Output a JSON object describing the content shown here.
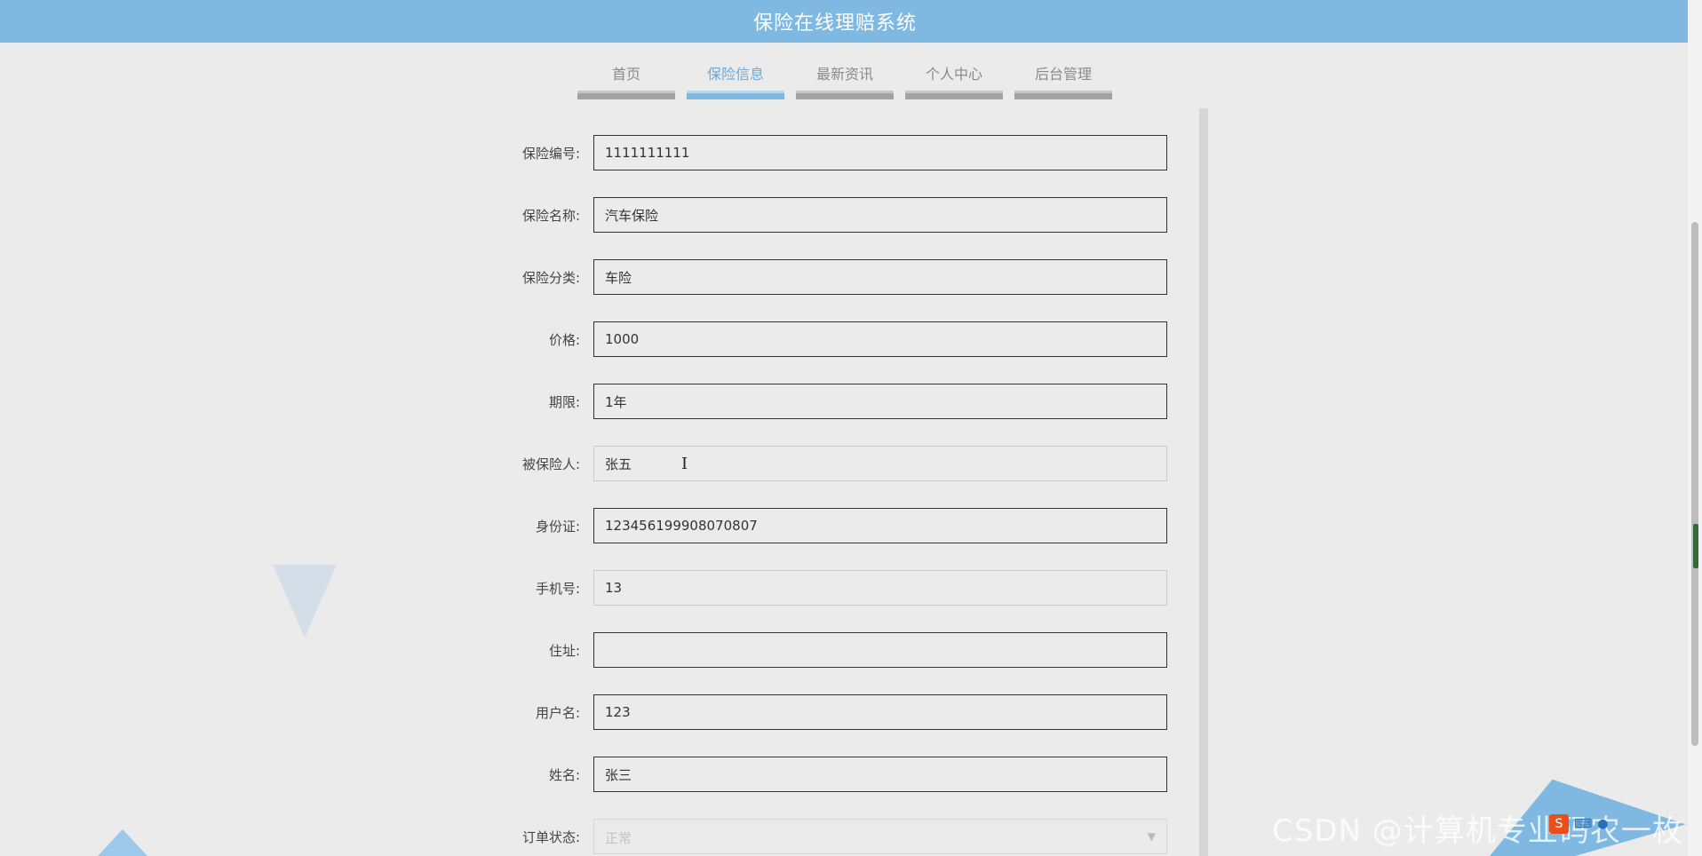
{
  "header": {
    "title": "保险在线理赔系统"
  },
  "nav": {
    "items": [
      {
        "label": "首页"
      },
      {
        "label": "保险信息"
      },
      {
        "label": "最新资讯"
      },
      {
        "label": "个人中心"
      },
      {
        "label": "后台管理"
      }
    ],
    "active": "保险信息"
  },
  "form": {
    "policy_no": {
      "label": "保险编号:",
      "value": "1111111111"
    },
    "policy_name": {
      "label": "保险名称:",
      "value": "汽车保险"
    },
    "category": {
      "label": "保险分类:",
      "value": "车险"
    },
    "price": {
      "label": "价格:",
      "value": "1000"
    },
    "term": {
      "label": "期限:",
      "value": "1年"
    },
    "insured": {
      "label": "被保险人:",
      "value": "张五"
    },
    "id_card": {
      "label": "身份证:",
      "value": "123456199908070807"
    },
    "phone": {
      "label": "手机号:",
      "value": "13"
    },
    "address": {
      "label": "住址:",
      "value": ""
    },
    "username": {
      "label": "用户名:",
      "value": "123"
    },
    "name": {
      "label": "姓名:",
      "value": "张三"
    },
    "order_status": {
      "label": "订单状态:",
      "value": "正常"
    }
  },
  "overlay": {
    "watermark": "CSDN @计算机专业码农一枚",
    "tray_logo": "S"
  },
  "colors": {
    "header_bg": "#7fb8e1",
    "active_nav": "#6ea8d8",
    "page_bg": "#ebebeb"
  },
  "icons": [
    "chevron-down-icon",
    "text-cursor-icon",
    "sogou-ime-icon",
    "keyboard-icon",
    "microphone-icon"
  ]
}
